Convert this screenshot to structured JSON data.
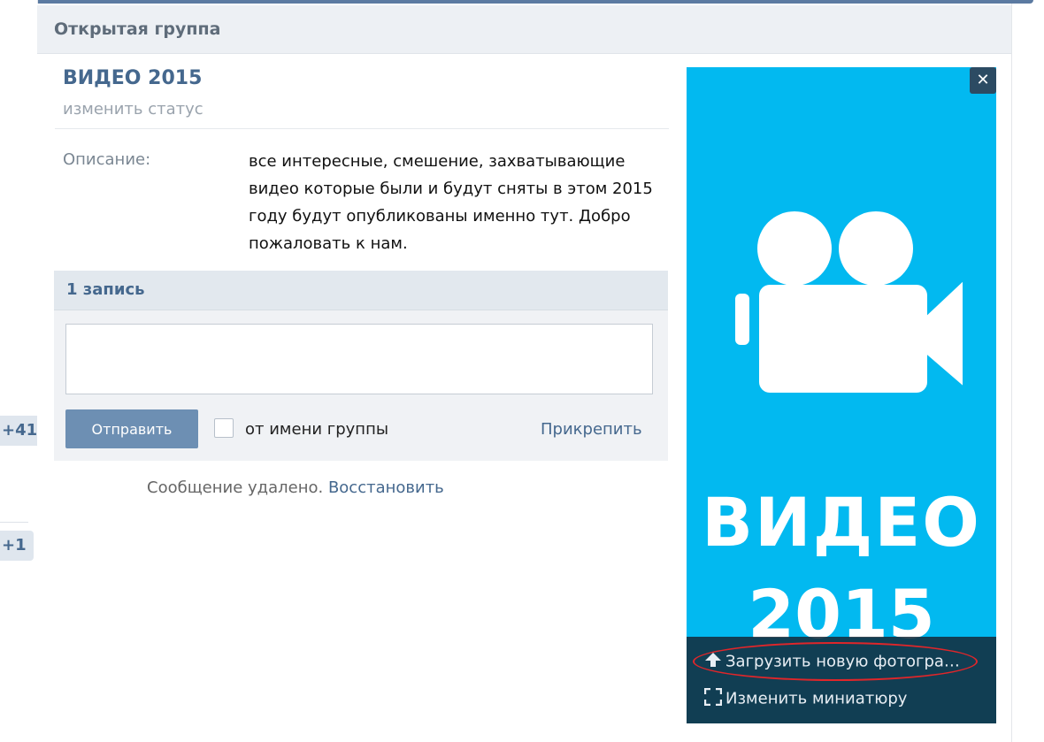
{
  "left_counters": [
    "+41",
    "+1"
  ],
  "header": {
    "title": "Открытая группа"
  },
  "group": {
    "name": "ВИДЕО 2015",
    "change_status": "изменить статус",
    "description_label": "Описание:",
    "description": "все интересные, смешение, захватывающие видео которые были и будут сняты в этом 2015 году будут опубликованы именно тут. Добро пожаловать к нам."
  },
  "wall": {
    "count_label": "1 запись",
    "input_value": "",
    "send_label": "Отправить",
    "from_group_label": "от имени группы",
    "from_group_checked": false,
    "attach_label": "Прикрепить"
  },
  "deleted": {
    "message": "Сообщение удалено.",
    "restore_label": "Восстановить"
  },
  "photo": {
    "close_icon": "close-icon",
    "title_line1": "ВИДЕО",
    "title_line2": "2015",
    "upload_label": "Загрузить новую фотогра…",
    "thumbnail_label": "Изменить миниатюру",
    "background_color": "#02b9f0",
    "highlight_color": "#e0262a"
  }
}
